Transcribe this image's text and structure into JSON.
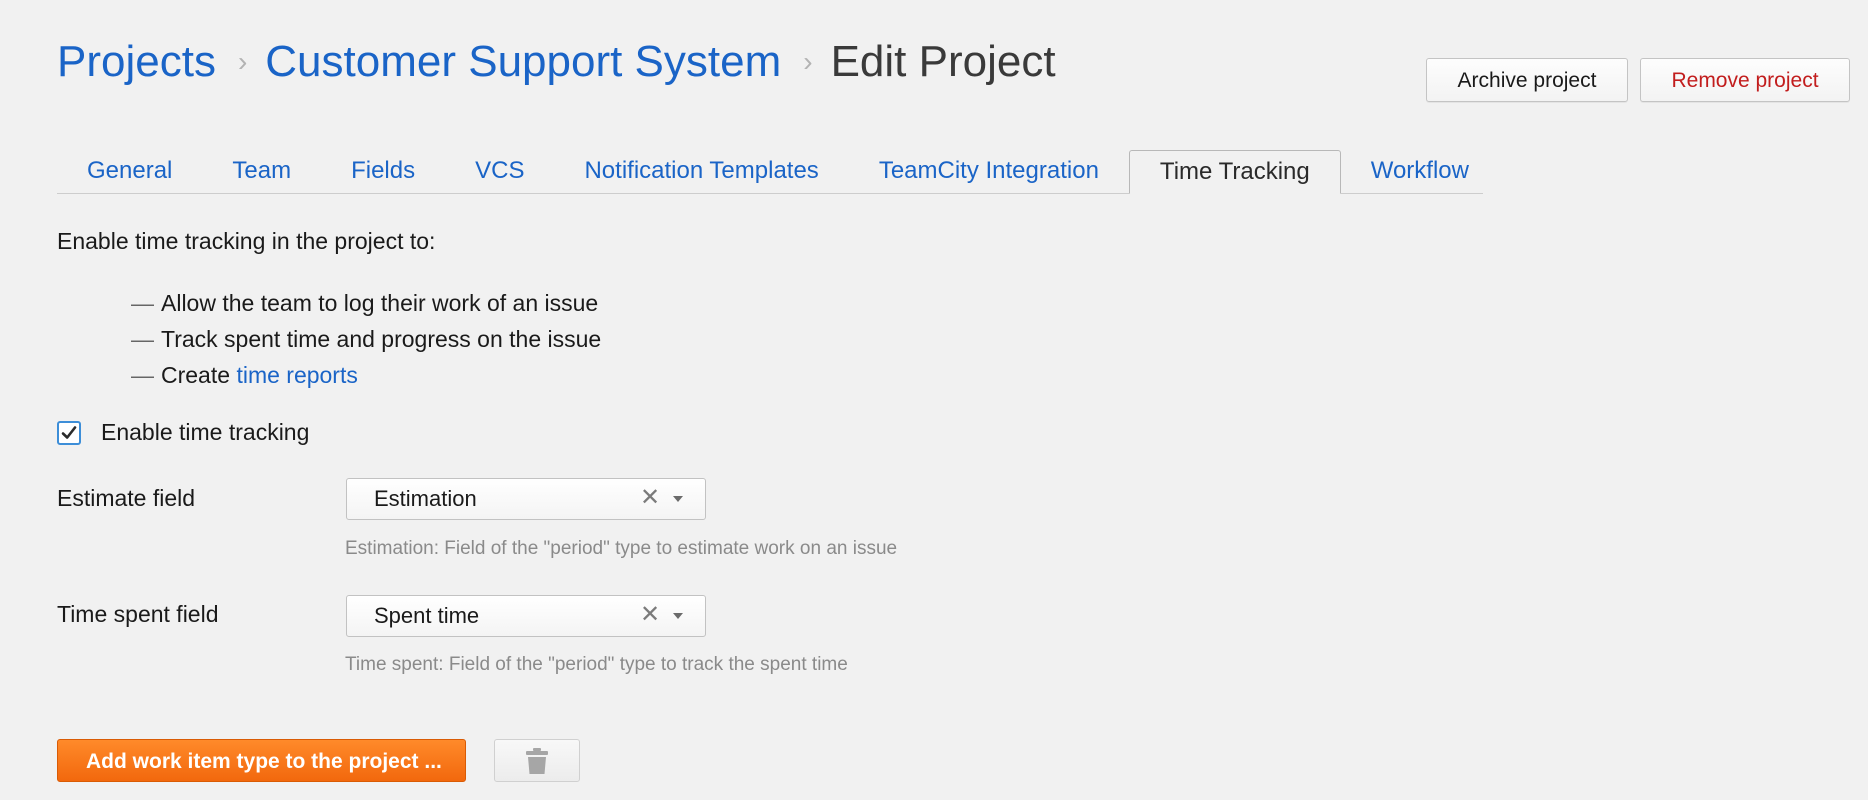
{
  "breadcrumb": {
    "items": [
      "Projects",
      "Customer Support System"
    ],
    "separator": "›",
    "current": "Edit Project"
  },
  "header_buttons": {
    "archive": "Archive project",
    "remove": "Remove project"
  },
  "tabs": [
    {
      "label": "General"
    },
    {
      "label": "Team"
    },
    {
      "label": "Fields"
    },
    {
      "label": "VCS"
    },
    {
      "label": "Notification Templates"
    },
    {
      "label": "TeamCity Integration"
    },
    {
      "label": "Time Tracking",
      "active": true
    },
    {
      "label": "Workflow"
    }
  ],
  "intro": "Enable time tracking in the project to:",
  "bullets": {
    "dash": "—",
    "item1": "Allow the team to log their work of an issue",
    "item2": "Track spent time and progress on the issue",
    "item3_prefix": "Create ",
    "item3_link": "time reports"
  },
  "enable_tracking": {
    "label": "Enable time tracking",
    "checked": true
  },
  "estimate": {
    "label": "Estimate field",
    "value": "Estimation",
    "clear": "✕",
    "hint": "Estimation: Field of the \"period\" type to estimate work on an issue"
  },
  "spent": {
    "label": "Time spent field",
    "value": "Spent time",
    "clear": "✕",
    "hint": "Time spent: Field of the \"period\" type to track the spent time"
  },
  "actions": {
    "add_work_item": "Add work item type to the project ...",
    "trash_icon": "trash-icon"
  },
  "colors": {
    "link": "#1a64c7",
    "remove": "#c21d1d",
    "primary": "#f2680d",
    "background": "#f1f1f1"
  }
}
